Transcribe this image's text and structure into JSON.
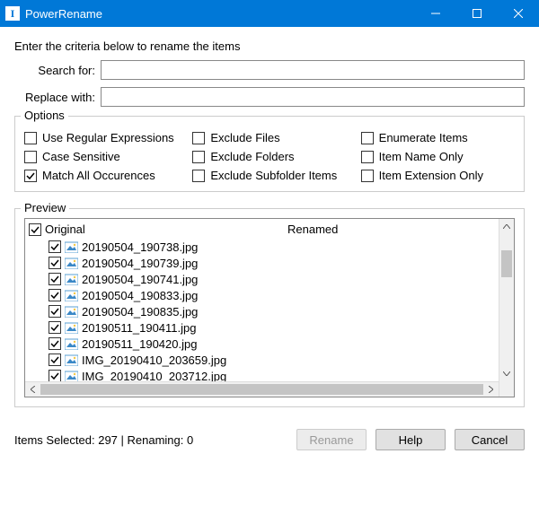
{
  "window": {
    "title": "PowerRename"
  },
  "criteria": {
    "instruction": "Enter the criteria below to rename the items",
    "search_label": "Search for:",
    "search_value": "",
    "replace_label": "Replace with:",
    "replace_value": ""
  },
  "options": {
    "group_label": "Options",
    "items": [
      {
        "label": "Use Regular Expressions",
        "checked": false
      },
      {
        "label": "Exclude Files",
        "checked": false
      },
      {
        "label": "Enumerate Items",
        "checked": false
      },
      {
        "label": "Case Sensitive",
        "checked": false
      },
      {
        "label": "Exclude Folders",
        "checked": false
      },
      {
        "label": "Item Name Only",
        "checked": false
      },
      {
        "label": "Match All Occurences",
        "checked": true
      },
      {
        "label": "Exclude Subfolder Items",
        "checked": false
      },
      {
        "label": "Item Extension Only",
        "checked": false
      }
    ]
  },
  "preview": {
    "group_label": "Preview",
    "header_original": "Original",
    "header_renamed": "Renamed",
    "root_checked": true,
    "files": [
      {
        "name": "20190504_190738.jpg",
        "checked": true
      },
      {
        "name": "20190504_190739.jpg",
        "checked": true
      },
      {
        "name": "20190504_190741.jpg",
        "checked": true
      },
      {
        "name": "20190504_190833.jpg",
        "checked": true
      },
      {
        "name": "20190504_190835.jpg",
        "checked": true
      },
      {
        "name": "20190511_190411.jpg",
        "checked": true
      },
      {
        "name": "20190511_190420.jpg",
        "checked": true
      },
      {
        "name": "IMG_20190410_203659.jpg",
        "checked": true
      },
      {
        "name": "IMG_20190410_203712.jpg",
        "checked": true
      }
    ]
  },
  "status": {
    "text": "Items Selected: 297 | Renaming: 0"
  },
  "buttons": {
    "rename": "Rename",
    "help": "Help",
    "cancel": "Cancel"
  }
}
